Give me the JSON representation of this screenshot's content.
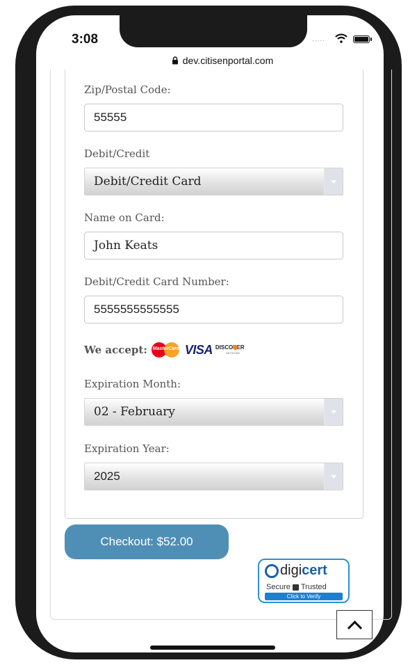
{
  "status_bar": {
    "time": "3:08",
    "dots": "....."
  },
  "browser": {
    "url": "dev.citisenportal.com"
  },
  "form": {
    "zip": {
      "label": "Zip/Postal Code:",
      "value": "55555"
    },
    "debit_credit": {
      "label": "Debit/Credit",
      "selected": "Debit/Credit Card"
    },
    "name_on_card": {
      "label": "Name on Card:",
      "value": "John Keats"
    },
    "card_number": {
      "label": "Debit/Credit Card Number:",
      "value": "5555555555555"
    },
    "accept": {
      "label": "We accept:",
      "logos": {
        "mastercard": "MasterCard",
        "visa": "VISA",
        "discover": "DISCOVER",
        "discover_sub": "NETWORK"
      }
    },
    "exp_month": {
      "label": "Expiration Month:",
      "selected": "02 - February"
    },
    "exp_year": {
      "label": "Expiration Year:",
      "selected": "2025"
    }
  },
  "checkout": {
    "label": "Checkout: $52.00"
  },
  "badge": {
    "brand_a": "digi",
    "brand_b": "cert",
    "secure": "Secure",
    "trusted": "Trusted",
    "verify": "Click to Verify"
  },
  "colors": {
    "checkout": "#4f8fb6",
    "digicert": "#1a5fa8",
    "frame": "#1b1b1b"
  }
}
